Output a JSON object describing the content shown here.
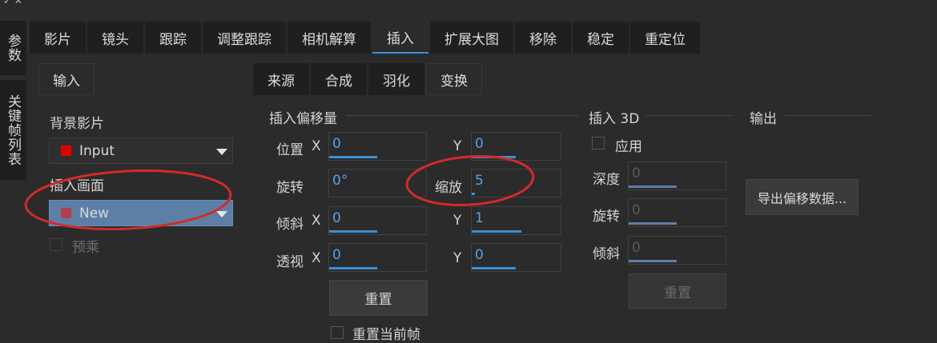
{
  "side_tabs": [
    {
      "label": "参数",
      "active": true
    },
    {
      "label": "关键帧列表",
      "active": false
    }
  ],
  "main_tabs": [
    {
      "label": "影片",
      "active": false
    },
    {
      "label": "镜头",
      "active": false
    },
    {
      "label": "跟踪",
      "active": false
    },
    {
      "label": "调整跟踪",
      "active": false
    },
    {
      "label": "相机解算",
      "active": false
    },
    {
      "label": "插入",
      "active": true
    },
    {
      "label": "扩展大图",
      "active": false
    },
    {
      "label": "移除",
      "active": false
    },
    {
      "label": "稳定",
      "active": false
    },
    {
      "label": "重定位",
      "active": false
    }
  ],
  "input_section": {
    "tab_label": "输入",
    "background_label": "背景影片",
    "background_value": "Input",
    "background_color": "#e00000",
    "insert_label": "插入画面",
    "insert_value": "New",
    "insert_color": "#b04050",
    "premultiply_label": "预乘"
  },
  "sub_tabs": [
    {
      "label": "来源",
      "active": false
    },
    {
      "label": "合成",
      "active": false
    },
    {
      "label": "羽化",
      "active": false
    },
    {
      "label": "变换",
      "active": true
    }
  ],
  "offset": {
    "title": "插入偏移量",
    "position_label": "位置",
    "rotation_label": "旋转",
    "skew_label": "倾斜",
    "perspective_label": "透视",
    "x_label": "X",
    "y_label": "Y",
    "scale_label": "缩放",
    "position_x": "0",
    "position_y": "0",
    "rotation": "0°",
    "scale": "5",
    "skew_x": "0",
    "skew_y": "1",
    "perspective_x": "0",
    "perspective_y": "0",
    "reset_label": "重置",
    "bottom_partial_label": "重置当前帧"
  },
  "insert3d": {
    "title": "插入 3D",
    "apply_label": "应用",
    "depth_label": "深度",
    "rotation_label": "旋转",
    "skew_label": "倾斜",
    "depth": "0",
    "rotation": "0",
    "skew": "0",
    "reset_label": "重置"
  },
  "output": {
    "title": "输出",
    "export_label": "导出偏移数据..."
  },
  "top_glyph": "✓ ✕",
  "annotation_color": "#d42a2a"
}
